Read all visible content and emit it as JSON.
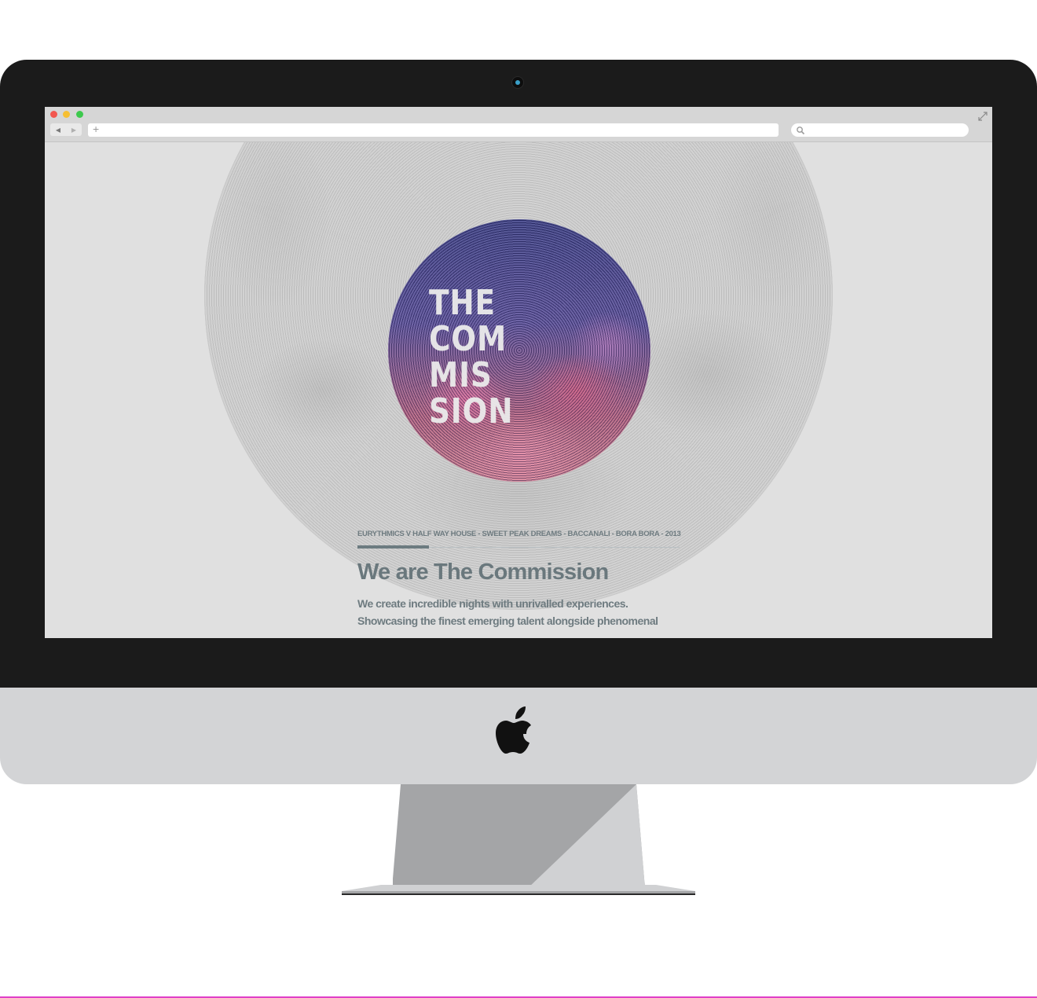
{
  "browser": {
    "nav_back": "◀",
    "nav_forward": "▶",
    "new_tab": "+",
    "address_value": "",
    "search_value": ""
  },
  "hero": {
    "logo_lines": [
      "THE",
      "COM",
      "MIS",
      "SION"
    ],
    "events": "EURYTHMICS V HALF WAY HOUSE - SWEET PEAK DREAMS - BACCANALI - BORA BORA - 2013",
    "headline": "We are The Commission",
    "body_line1": "We create incredible nights with unrivalled experiences.",
    "body_line2": "Showcasing the finest emerging talent alongside phenomenal"
  },
  "colors": {
    "text_accent": "#6a787d",
    "traffic_close": "#f2574f",
    "traffic_minimize": "#f6bf33",
    "traffic_maximize": "#3dc94d"
  },
  "icons": [
    "camera-icon",
    "apple-logo-icon",
    "search-icon",
    "fullscreen-icon",
    "plus-icon"
  ]
}
